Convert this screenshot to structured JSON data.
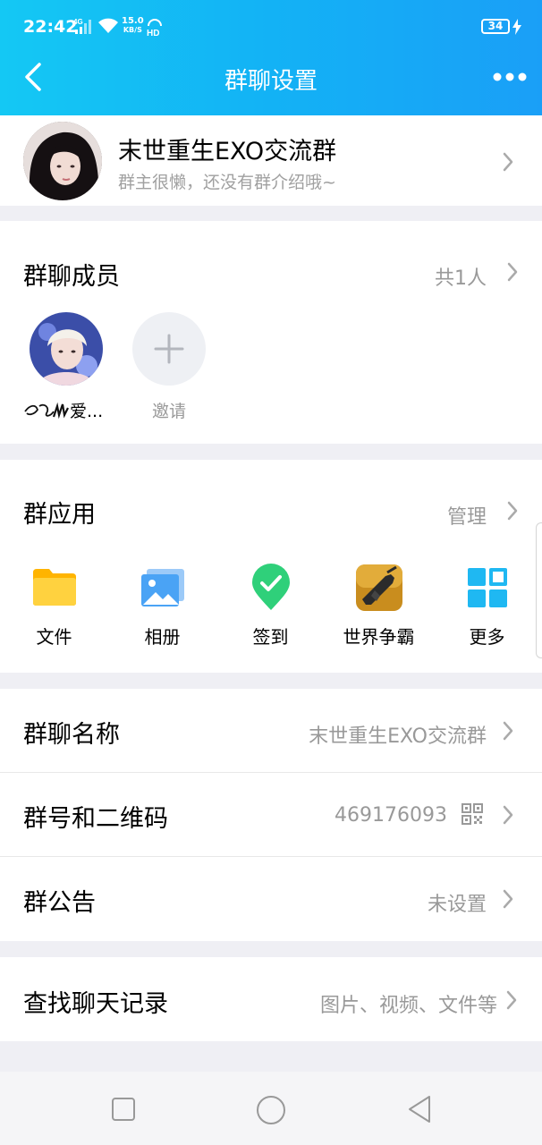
{
  "status": {
    "time": "22:42",
    "network": "4G",
    "speed_top": "15.0",
    "speed_bottom": "KB/S",
    "hd": "HD",
    "battery": "34"
  },
  "nav": {
    "title": "群聊设置"
  },
  "group": {
    "name": "末世重生EXO交流群",
    "intro": "群主很懒，还没有群介绍哦~"
  },
  "members": {
    "title": "群聊成员",
    "count": "共1人",
    "list": [
      {
        "name": "爱..."
      }
    ],
    "invite_label": "邀请"
  },
  "apps": {
    "title": "群应用",
    "manage": "管理",
    "items": [
      {
        "label": "文件",
        "icon": "folder-icon"
      },
      {
        "label": "相册",
        "icon": "photo-album-icon"
      },
      {
        "label": "签到",
        "icon": "check-in-icon"
      },
      {
        "label": "世界争霸",
        "icon": "game-gun-icon"
      },
      {
        "label": "更多",
        "icon": "more-grid-icon"
      }
    ]
  },
  "settings": {
    "name_title": "群聊名称",
    "name_value": "末世重生EXO交流群",
    "number_title": "群号和二维码",
    "number_value": "469176093",
    "notice_title": "群公告",
    "notice_value": "未设置",
    "search_title": "查找聊天记录",
    "search_value": "图片、视频、文件等"
  },
  "colors": {
    "header": "#13b2f5",
    "folder": "#ffc61a",
    "album": "#4aa3f5",
    "checkin": "#2fd07a",
    "more": "#1fb8f2"
  }
}
